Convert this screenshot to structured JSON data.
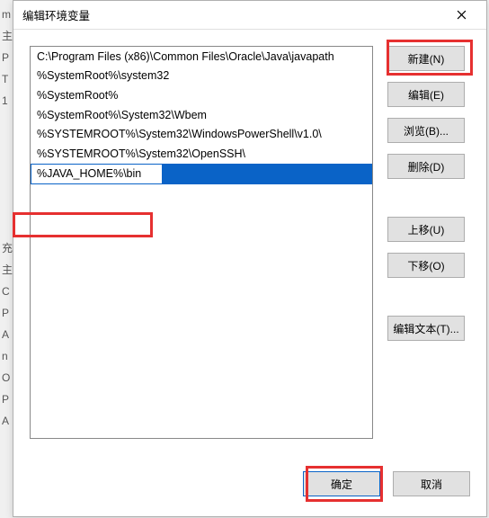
{
  "dialog": {
    "title": "编辑环境变量",
    "close_icon": "×"
  },
  "paths": [
    "C:\\Program Files (x86)\\Common Files\\Oracle\\Java\\javapath",
    "%SystemRoot%\\system32",
    "%SystemRoot%",
    "%SystemRoot%\\System32\\Wbem",
    "%SYSTEMROOT%\\System32\\WindowsPowerShell\\v1.0\\",
    "%SYSTEMROOT%\\System32\\OpenSSH\\"
  ],
  "editing_value": "%JAVA_HOME%\\bin",
  "buttons": {
    "new": "新建(N)",
    "edit": "编辑(E)",
    "browse": "浏览(B)...",
    "delete": "删除(D)",
    "moveup": "上移(U)",
    "movedown": "下移(O)",
    "edittext": "编辑文本(T)...",
    "ok": "确定",
    "cancel": "取消"
  },
  "bg_chars": [
    "m",
    "主",
    "P",
    "T",
    "1",
    "",
    "",
    "",
    "",
    "",
    "",
    "",
    "充",
    "主",
    "C",
    "P",
    "A",
    "n",
    "O",
    "P",
    "A"
  ]
}
